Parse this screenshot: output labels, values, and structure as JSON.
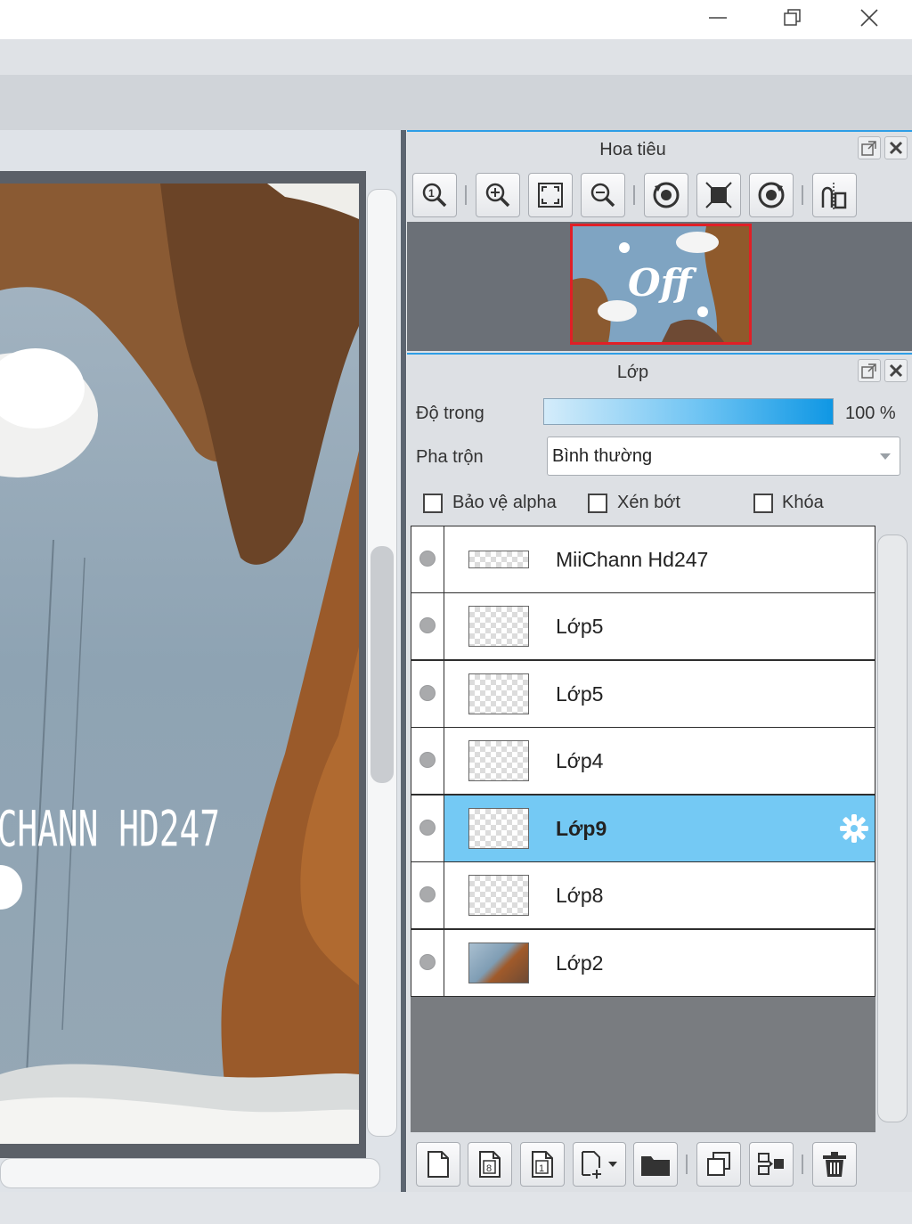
{
  "window": {
    "minimize_icon": "minimize-icon",
    "maximize_icon": "restore-icon",
    "close_icon": "close-icon"
  },
  "canvas": {
    "artwork_text": "CHANN HD247"
  },
  "navigator": {
    "title": "Hoa tiêu",
    "thumbnail_text": "Off",
    "tools": [
      "zoom-100-icon",
      "zoom-in-icon",
      "fit-screen-icon",
      "zoom-out-icon",
      "rotate-left-icon",
      "fit-frame-icon",
      "rotate-right-icon",
      "flip-icon"
    ]
  },
  "layers_panel": {
    "title": "Lớp",
    "opacity_label": "Độ trong",
    "opacity_value": "100 %",
    "opacity_fraction": 1.0,
    "blend_label": "Pha trộn",
    "blend_value": "Bình thường",
    "protect_alpha_label": "Bảo vệ alpha",
    "clipping_label": "Xén bớt",
    "lock_label": "Khóa",
    "layers": [
      {
        "name": "MiiChann Hd247",
        "thumb": "text",
        "selected": false
      },
      {
        "name": "Lớp5",
        "thumb": "transparent",
        "selected": false
      },
      {
        "name": "Lớp5",
        "thumb": "transparent",
        "selected": false
      },
      {
        "name": "Lớp4",
        "thumb": "transparent",
        "selected": false
      },
      {
        "name": "Lớp9",
        "thumb": "transparent",
        "selected": true
      },
      {
        "name": "Lớp8",
        "thumb": "transparent",
        "selected": false
      },
      {
        "name": "Lớp2",
        "thumb": "photo",
        "selected": false
      }
    ],
    "bottom_tools": [
      "new-layer-icon",
      "new-8bit-layer-icon",
      "new-1bit-layer-icon",
      "add-layer-menu-icon",
      "folder-icon",
      "duplicate-layer-icon",
      "merge-down-icon",
      "delete-layer-icon"
    ]
  }
}
